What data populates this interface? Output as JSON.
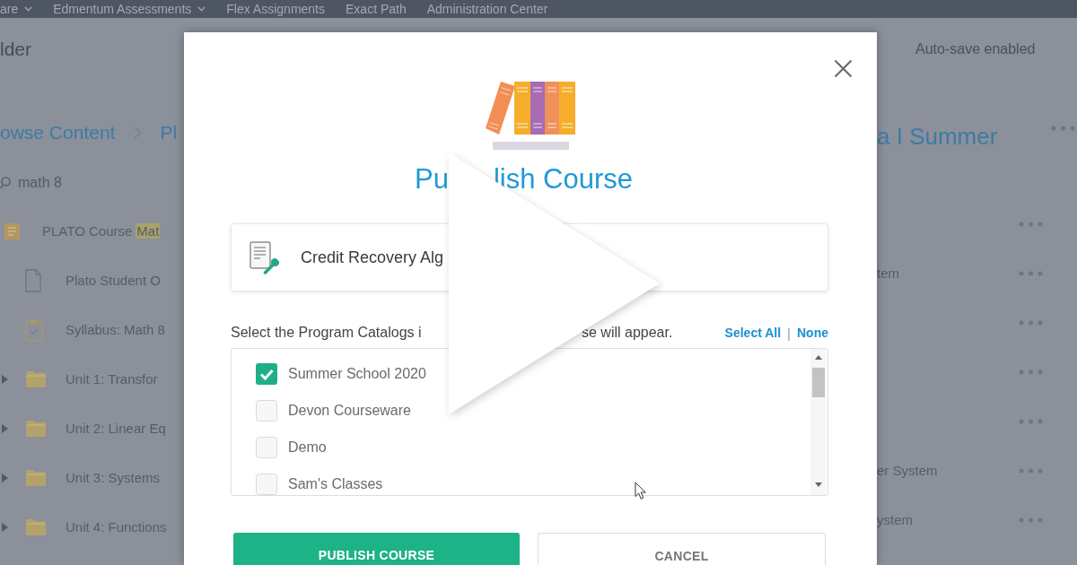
{
  "top_nav": {
    "items": [
      {
        "label": "are",
        "dropdown": true
      },
      {
        "label": "Edmentum Assessments",
        "dropdown": true
      },
      {
        "label": "Flex Assignments",
        "dropdown": false
      },
      {
        "label": "Exact Path",
        "dropdown": false
      },
      {
        "label": "Administration Center",
        "dropdown": false
      }
    ]
  },
  "page_header": {
    "title": "lder",
    "status": "Auto-save enabled"
  },
  "breadcrumb": {
    "items": [
      "owse Content",
      "Pl"
    ],
    "course_title": "a I Summer"
  },
  "search": {
    "value": "math 8"
  },
  "tree": {
    "items": [
      {
        "kind": "course",
        "label": "PLATO Course",
        "match": "Mat",
        "children": [
          {
            "kind": "document",
            "label": "Plato Student O"
          },
          {
            "kind": "syllabus",
            "label": "Syllabus: Math 8"
          },
          {
            "kind": "folder",
            "label": "Unit 1: Transfor",
            "expanded": false
          },
          {
            "kind": "folder",
            "label": "Unit 2: Linear Eq",
            "expanded": false
          },
          {
            "kind": "folder",
            "label": "Unit 3: Systems",
            "expanded": false
          },
          {
            "kind": "folder",
            "label": "Unit 4: Functions",
            "expanded": false
          }
        ]
      }
    ]
  },
  "right_rows": [
    {
      "kind": "more"
    },
    {
      "kind": "text",
      "label": "tem"
    },
    {
      "kind": "more"
    },
    {
      "kind": "more"
    },
    {
      "kind": "more"
    },
    {
      "kind": "text",
      "label": "er System"
    },
    {
      "kind": "text",
      "label": "ystem"
    }
  ],
  "modal": {
    "title_parts": [
      "Pu",
      "lish Course"
    ],
    "course_name": "Credit Recovery Alg",
    "instruction_parts": [
      "Select the Program Catalogs i",
      "se will appear."
    ],
    "links": [
      "Select All",
      "None"
    ],
    "link_separator": "|",
    "catalogs": [
      {
        "label": "Summer School 2020",
        "checked": true
      },
      {
        "label": "Devon Courseware",
        "checked": false
      },
      {
        "label": "Demo",
        "checked": false
      },
      {
        "label": "Sam's Classes",
        "checked": false
      }
    ],
    "buttons": [
      {
        "label": "PUBLISH COURSE",
        "kind": "primary"
      },
      {
        "label": "CANCEL",
        "kind": "secondary"
      }
    ]
  }
}
